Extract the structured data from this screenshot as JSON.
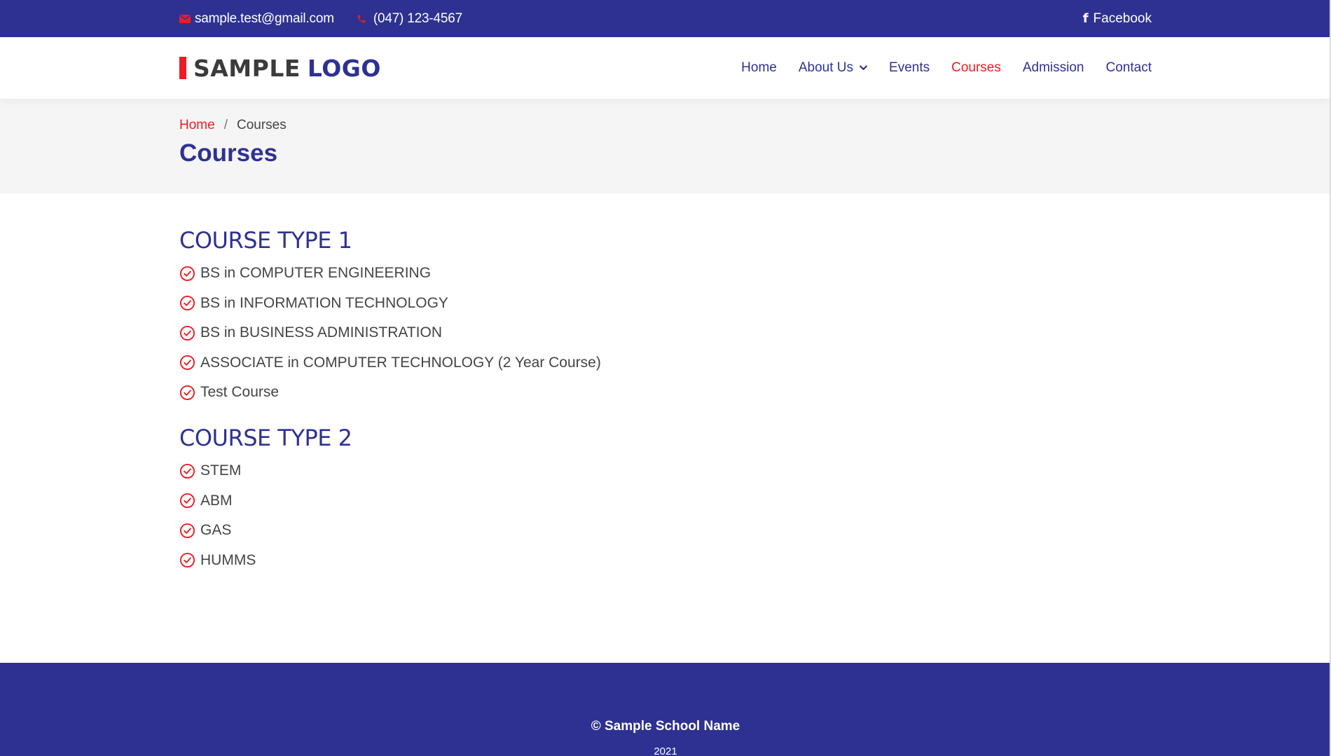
{
  "colors": {
    "primary": "#2e3192",
    "accent": "#ed1c24",
    "text": "#444444",
    "band": "#f5f5f5"
  },
  "topbar": {
    "email": {
      "icon": "envelope-icon",
      "text": "sample.test@gmail.com"
    },
    "phone": {
      "icon": "phone-icon",
      "text": "(047) 123-4567"
    },
    "social": {
      "icon": "facebook-icon",
      "text": "Facebook"
    }
  },
  "header": {
    "logo": {
      "word1": "SAMPLE",
      "word2": "LOGO"
    },
    "nav": {
      "home": "Home",
      "about": "About Us",
      "events": "Events",
      "courses": "Courses",
      "admission": "Admission",
      "contact": "Contact",
      "active": "Courses"
    }
  },
  "breadcrumb": {
    "home": "Home",
    "separator": "/",
    "current": "Courses"
  },
  "page_title": "Courses",
  "sections": [
    {
      "title": "COURSE TYPE 1",
      "items": [
        "BS in COMPUTER ENGINEERING",
        "BS in INFORMATION TECHNOLOGY",
        "BS in BUSINESS ADMINISTRATION",
        "ASSOCIATE in COMPUTER TECHNOLOGY (2 Year Course)",
        "Test Course"
      ]
    },
    {
      "title": "COURSE TYPE 2",
      "items": [
        "STEM",
        "ABM",
        "GAS",
        "HUMMS"
      ]
    }
  ],
  "footer": {
    "copyright": "© Sample School Name",
    "year": "2021"
  }
}
